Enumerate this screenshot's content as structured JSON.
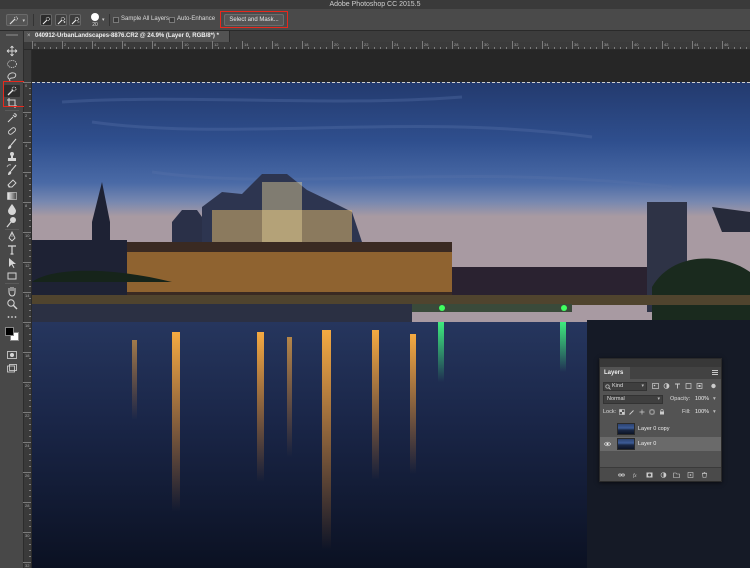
{
  "app": {
    "title": "Adobe Photoshop CC 2015.5"
  },
  "options_bar": {
    "brush_size": "20",
    "sample_all_layers_label": "Sample All Layers",
    "auto_enhance_label": "Auto-Enhance",
    "select_and_mask_label": "Select and Mask...",
    "highlight_color": "#e8281c"
  },
  "document": {
    "tab_title": "040912-UrbanLandscapes-8876.CR2 @ 24.9% (Layer 0, RGB/8*) *",
    "close_glyph": "×"
  },
  "rulers": {
    "horizontal_labels": [
      "0",
      "2",
      "4",
      "6",
      "8",
      "10",
      "12",
      "14",
      "16",
      "18",
      "20",
      "22",
      "24",
      "26",
      "28",
      "30",
      "32",
      "34",
      "36",
      "38",
      "40",
      "42",
      "44",
      "46"
    ],
    "vertical_labels": [
      "0",
      "2",
      "4",
      "6",
      "8",
      "10",
      "12",
      "14",
      "16",
      "18",
      "20",
      "22",
      "24",
      "26",
      "28",
      "30",
      "32"
    ]
  },
  "toolbar": {
    "tools": [
      {
        "name": "move-tool-icon"
      },
      {
        "name": "marquee-tool-icon"
      },
      {
        "name": "lasso-tool-icon"
      },
      {
        "name": "quick-selection-tool-icon",
        "active": true
      },
      {
        "name": "crop-tool-icon"
      },
      {
        "name": "eyedropper-tool-icon"
      },
      {
        "name": "healing-brush-tool-icon"
      },
      {
        "name": "brush-tool-icon"
      },
      {
        "name": "clone-stamp-tool-icon"
      },
      {
        "name": "history-brush-tool-icon"
      },
      {
        "name": "eraser-tool-icon"
      },
      {
        "name": "gradient-tool-icon"
      },
      {
        "name": "blur-tool-icon"
      },
      {
        "name": "dodge-tool-icon"
      },
      {
        "name": "pen-tool-icon"
      },
      {
        "name": "type-tool-icon"
      },
      {
        "name": "path-selection-tool-icon"
      },
      {
        "name": "rectangle-tool-icon"
      },
      {
        "name": "hand-tool-icon"
      },
      {
        "name": "zoom-tool-icon"
      },
      {
        "name": "edit-toolbar-icon"
      },
      {
        "name": "color-swatches-icon"
      },
      {
        "name": "quick-mask-icon"
      },
      {
        "name": "screen-mode-icon"
      }
    ]
  },
  "layers_panel": {
    "tab_label": "Layers",
    "kind_label": "Kind",
    "blend_mode": "Normal",
    "opacity_label": "Opacity:",
    "opacity_value": "100%",
    "lock_label": "Lock:",
    "fill_label": "Fill:",
    "fill_value": "100%",
    "layers": [
      {
        "name": "Layer 0 copy",
        "visible": false,
        "selected": false
      },
      {
        "name": "Layer 0",
        "visible": true,
        "selected": true
      }
    ]
  }
}
